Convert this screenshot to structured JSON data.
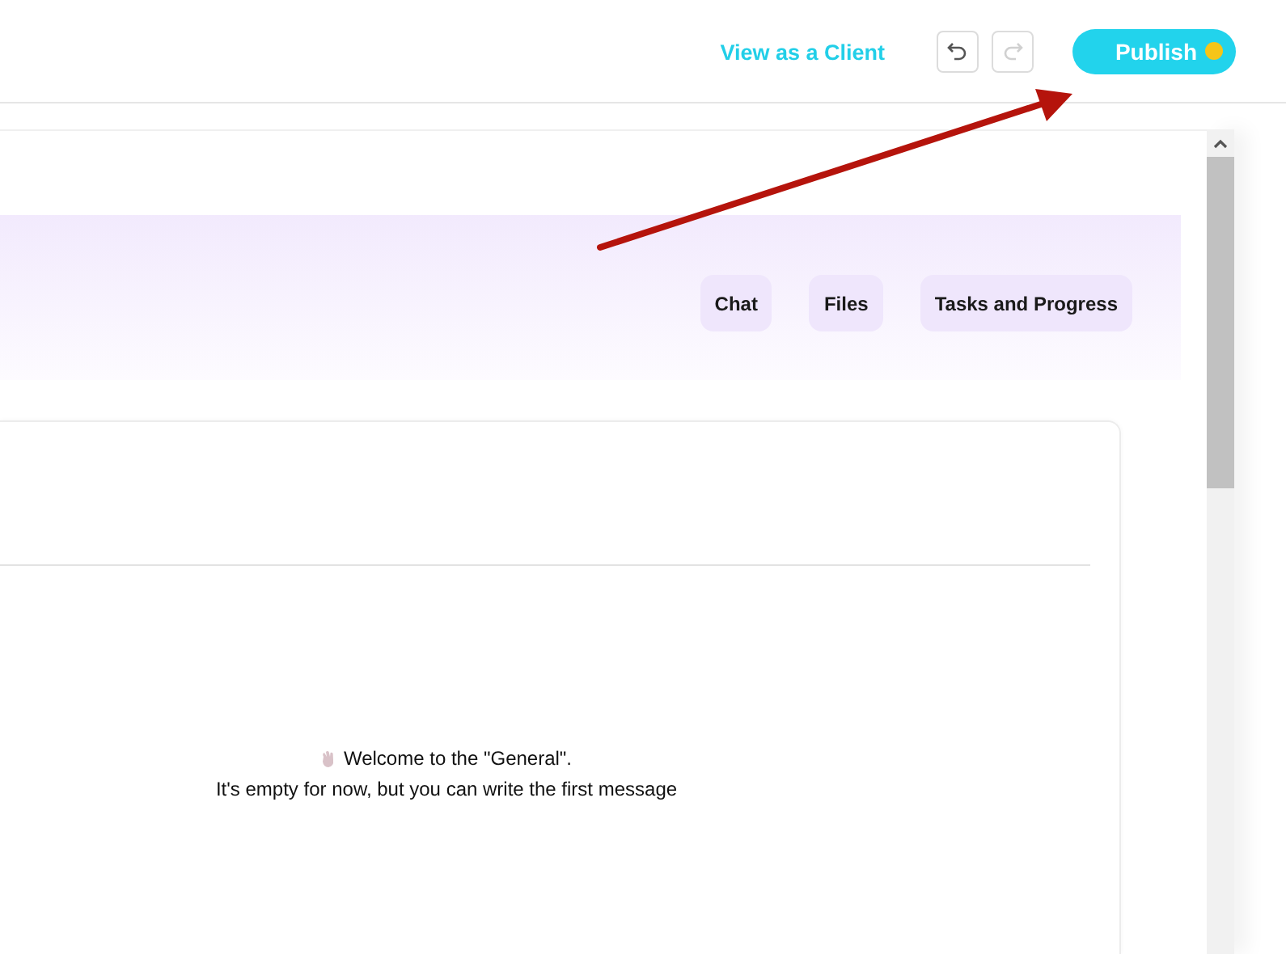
{
  "top_bar": {
    "view_link": "View as a Client",
    "undo": {
      "disabled": false
    },
    "redo": {
      "disabled": true
    },
    "publish": {
      "label": "Publish",
      "unsaved": true
    }
  },
  "header_tabs": [
    {
      "label": "Chat"
    },
    {
      "label": "Files"
    },
    {
      "label": "Tasks and Progress"
    }
  ],
  "chat": {
    "welcome": "Welcome to the \"General\".",
    "hint": "It's empty for now, but you can write the first message"
  }
}
